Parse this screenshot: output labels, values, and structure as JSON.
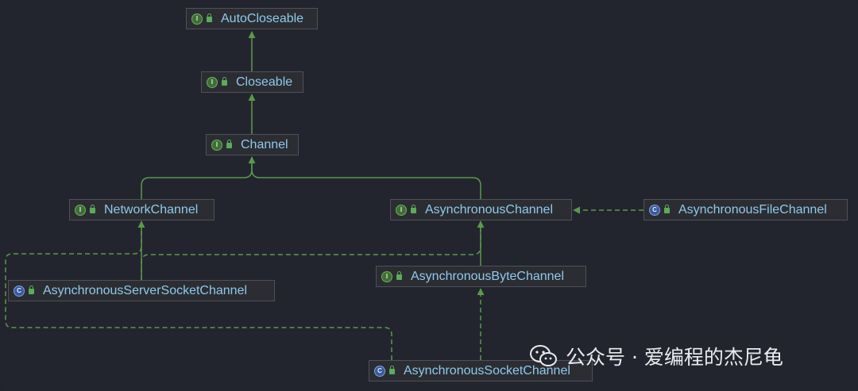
{
  "diagram": {
    "nodes": {
      "auto_closeable": {
        "label": "AutoCloseable",
        "badge": "I",
        "kind": "interface"
      },
      "closeable": {
        "label": "Closeable",
        "badge": "I",
        "kind": "interface"
      },
      "channel": {
        "label": "Channel",
        "badge": "I",
        "kind": "interface"
      },
      "network_channel": {
        "label": "NetworkChannel",
        "badge": "I",
        "kind": "interface"
      },
      "asynchronous_channel": {
        "label": "AsynchronousChannel",
        "badge": "I",
        "kind": "interface"
      },
      "asynchronous_file_channel": {
        "label": "AsynchronousFileChannel",
        "badge": "C",
        "kind": "class"
      },
      "asynchronous_byte_channel": {
        "label": "AsynchronousByteChannel",
        "badge": "I",
        "kind": "interface"
      },
      "asynchronous_server_socket_channel": {
        "label": "AsynchronousServerSocketChannel",
        "badge": "C",
        "kind": "class"
      },
      "asynchronous_socket_channel": {
        "label": "AsynchronousSocketChannel",
        "badge": "C",
        "kind": "class"
      }
    },
    "edges": [
      {
        "from": "closeable",
        "to": "auto_closeable",
        "style": "extends"
      },
      {
        "from": "channel",
        "to": "closeable",
        "style": "extends"
      },
      {
        "from": "network_channel",
        "to": "channel",
        "style": "extends"
      },
      {
        "from": "asynchronous_channel",
        "to": "channel",
        "style": "extends"
      },
      {
        "from": "asynchronous_file_channel",
        "to": "asynchronous_channel",
        "style": "implements"
      },
      {
        "from": "asynchronous_byte_channel",
        "to": "asynchronous_channel",
        "style": "extends"
      },
      {
        "from": "asynchronous_server_socket_channel",
        "to": "network_channel",
        "style": "implements"
      },
      {
        "from": "asynchronous_server_socket_channel",
        "to": "asynchronous_channel",
        "style": "implements"
      },
      {
        "from": "asynchronous_socket_channel",
        "to": "network_channel",
        "style": "implements"
      },
      {
        "from": "asynchronous_socket_channel",
        "to": "asynchronous_byte_channel",
        "style": "implements"
      }
    ],
    "colors": {
      "background": "#23252e",
      "node_fill": "#2b2d33",
      "node_border": "#4e5157",
      "node_text": "#8fc9ea",
      "edge": "#5a9a4b",
      "interface_badge": "#6eb05f",
      "class_badge": "#7fa0df"
    }
  },
  "watermark": {
    "text": "公众号 · 爱编程的杰尼龟",
    "icon": "wechat-icon"
  }
}
